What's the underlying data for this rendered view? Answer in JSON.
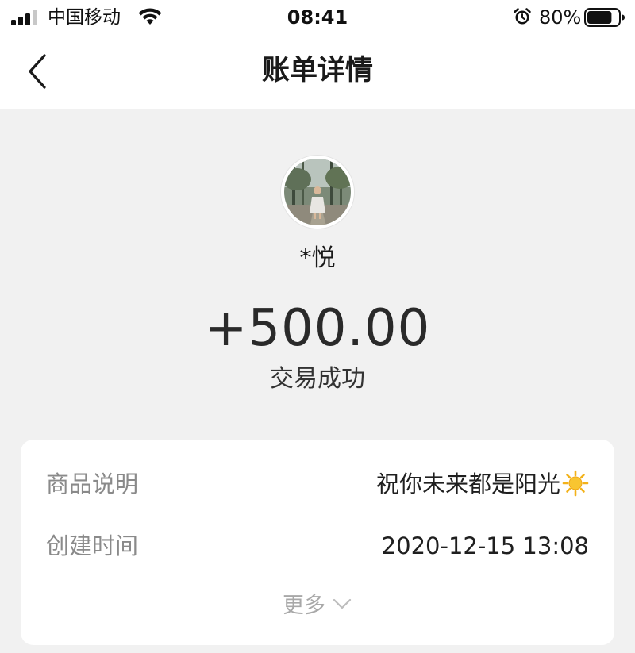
{
  "status_bar": {
    "carrier": "中国移动",
    "time": "08:41",
    "battery_percent": "80%",
    "battery_level": 0.8
  },
  "nav": {
    "title": "账单详情"
  },
  "transaction": {
    "name": "*悦",
    "amount": "+500.00",
    "status": "交易成功"
  },
  "details": {
    "rows": [
      {
        "label": "商品说明",
        "value": "祝你未来都是阳光"
      },
      {
        "label": "创建时间",
        "value": "2020-12-15 13:08"
      }
    ],
    "more_label": "更多"
  },
  "icons": {
    "signal": "signal-icon",
    "wifi": "wifi-icon",
    "alarm": "alarm-icon",
    "battery": "battery-icon",
    "back": "back-chevron-icon",
    "sun": "sun-emoji-icon",
    "more": "chevron-down-icon"
  },
  "colors": {
    "background": "#f1f1f1",
    "card": "#ffffff",
    "label_gray": "#8a8a8a",
    "text_dark": "#1a1a1a"
  }
}
